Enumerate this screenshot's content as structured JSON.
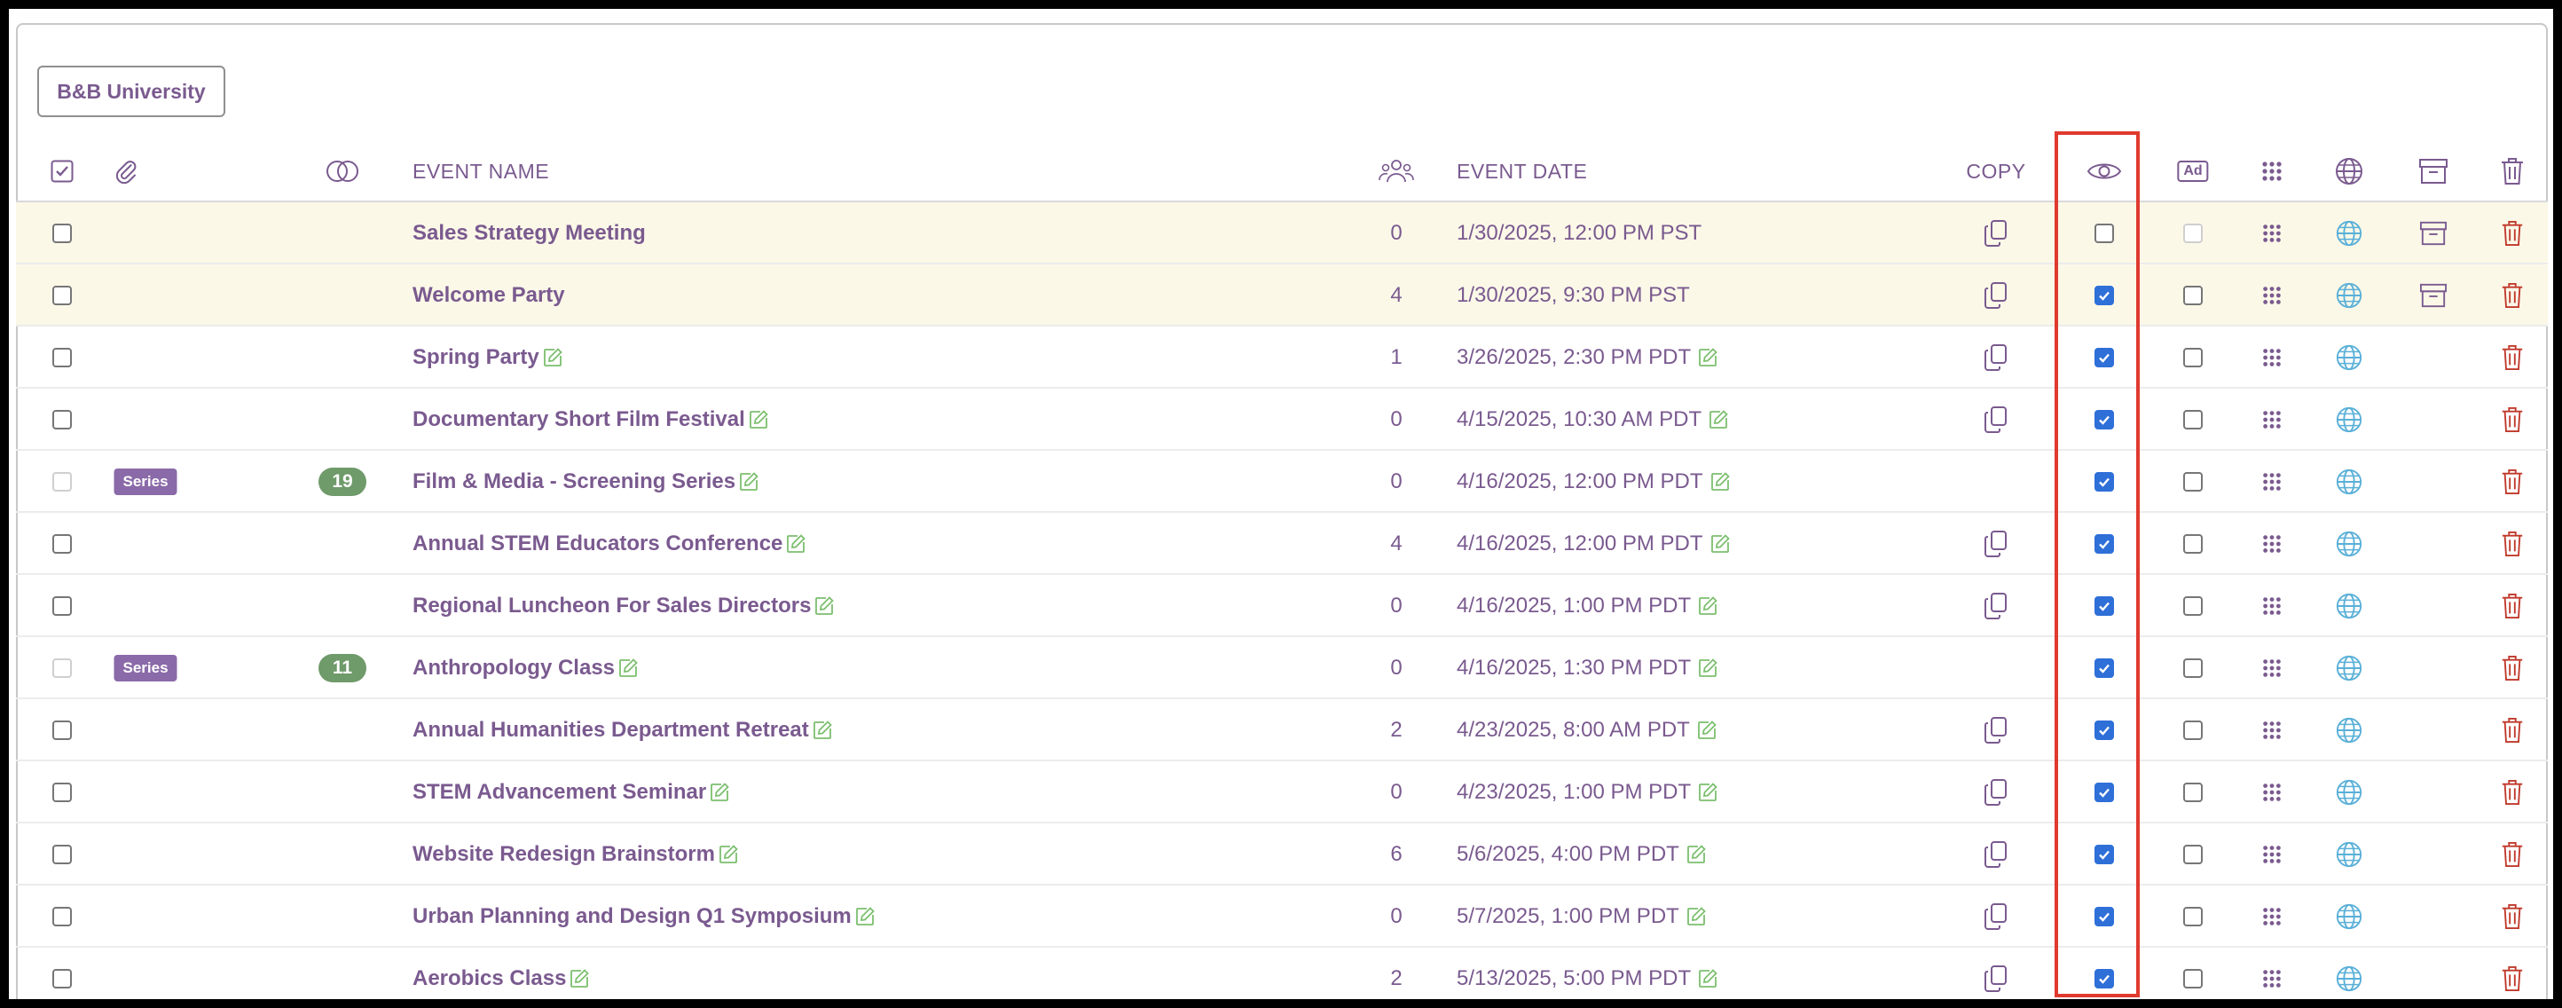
{
  "toolbar": {
    "tag_label": "B&B University"
  },
  "headers": {
    "event_name": "EVENT NAME",
    "event_date": "EVENT DATE",
    "copy": "COPY",
    "ad": "Ad"
  },
  "colors": {
    "accent": "#7a5a8f",
    "highlight_row": "#fbf8e8",
    "checkbox_checked": "#2e6fd8",
    "edit_icon": "#7cbf6e",
    "globe_icon": "#5ab0d8",
    "delete_icon": "#c0392b",
    "series_badge": "#8a6aa8",
    "count_badge": "#6f9a6a",
    "focus_box": "#e03a2f"
  },
  "rows": [
    {
      "name": "Sales Strategy Meeting",
      "attendees": "0",
      "date": "1/30/2025, 12:00 PM PST",
      "series": false,
      "series_label": "",
      "series_count": "",
      "editable": false,
      "copy": true,
      "visible": false,
      "ad": false,
      "ad_disabled": true,
      "archive": true,
      "highlight": true,
      "select_disabled": false
    },
    {
      "name": "Welcome Party",
      "attendees": "4",
      "date": "1/30/2025, 9:30 PM PST",
      "series": false,
      "series_label": "",
      "series_count": "",
      "editable": false,
      "copy": true,
      "visible": true,
      "ad": false,
      "ad_disabled": false,
      "archive": true,
      "highlight": true,
      "select_disabled": false
    },
    {
      "name": "Spring Party",
      "attendees": "1",
      "date": "3/26/2025, 2:30 PM PDT",
      "series": false,
      "series_label": "",
      "series_count": "",
      "editable": true,
      "copy": true,
      "visible": true,
      "ad": false,
      "ad_disabled": false,
      "archive": false,
      "highlight": false,
      "select_disabled": false
    },
    {
      "name": "Documentary Short Film Festival",
      "attendees": "0",
      "date": "4/15/2025, 10:30 AM PDT",
      "series": false,
      "series_label": "",
      "series_count": "",
      "editable": true,
      "copy": true,
      "visible": true,
      "ad": false,
      "ad_disabled": false,
      "archive": false,
      "highlight": false,
      "select_disabled": false
    },
    {
      "name": "Film & Media - Screening Series",
      "attendees": "0",
      "date": "4/16/2025, 12:00 PM PDT",
      "series": true,
      "series_label": "Series",
      "series_count": "19",
      "editable": true,
      "copy": false,
      "visible": true,
      "ad": false,
      "ad_disabled": false,
      "archive": false,
      "highlight": false,
      "select_disabled": true
    },
    {
      "name": "Annual STEM Educators Conference",
      "attendees": "4",
      "date": "4/16/2025, 12:00 PM PDT",
      "series": false,
      "series_label": "",
      "series_count": "",
      "editable": true,
      "copy": true,
      "visible": true,
      "ad": false,
      "ad_disabled": false,
      "archive": false,
      "highlight": false,
      "select_disabled": false
    },
    {
      "name": "Regional Luncheon For Sales Directors",
      "attendees": "0",
      "date": "4/16/2025, 1:00 PM PDT",
      "series": false,
      "series_label": "",
      "series_count": "",
      "editable": true,
      "copy": true,
      "visible": true,
      "ad": false,
      "ad_disabled": false,
      "archive": false,
      "highlight": false,
      "select_disabled": false
    },
    {
      "name": "Anthropology Class",
      "attendees": "0",
      "date": "4/16/2025, 1:30 PM PDT",
      "series": true,
      "series_label": "Series",
      "series_count": "11",
      "editable": true,
      "copy": false,
      "visible": true,
      "ad": false,
      "ad_disabled": false,
      "archive": false,
      "highlight": false,
      "select_disabled": true
    },
    {
      "name": "Annual Humanities Department Retreat",
      "attendees": "2",
      "date": "4/23/2025, 8:00 AM PDT",
      "series": false,
      "series_label": "",
      "series_count": "",
      "editable": true,
      "copy": true,
      "visible": true,
      "ad": false,
      "ad_disabled": false,
      "archive": false,
      "highlight": false,
      "select_disabled": false
    },
    {
      "name": "STEM Advancement Seminar",
      "attendees": "0",
      "date": "4/23/2025, 1:00 PM PDT",
      "series": false,
      "series_label": "",
      "series_count": "",
      "editable": true,
      "copy": true,
      "visible": true,
      "ad": false,
      "ad_disabled": false,
      "archive": false,
      "highlight": false,
      "select_disabled": false
    },
    {
      "name": "Website Redesign Brainstorm",
      "attendees": "6",
      "date": "5/6/2025, 4:00 PM PDT",
      "series": false,
      "series_label": "",
      "series_count": "",
      "editable": true,
      "copy": true,
      "visible": true,
      "ad": false,
      "ad_disabled": false,
      "archive": false,
      "highlight": false,
      "select_disabled": false
    },
    {
      "name": "Urban Planning and Design Q1 Symposium",
      "attendees": "0",
      "date": "5/7/2025, 1:00 PM PDT",
      "series": false,
      "series_label": "",
      "series_count": "",
      "editable": true,
      "copy": true,
      "visible": true,
      "ad": false,
      "ad_disabled": false,
      "archive": false,
      "highlight": false,
      "select_disabled": false
    },
    {
      "name": "Aerobics Class",
      "attendees": "2",
      "date": "5/13/2025, 5:00 PM PDT",
      "series": false,
      "series_label": "",
      "series_count": "",
      "editable": true,
      "copy": true,
      "visible": true,
      "ad": false,
      "ad_disabled": false,
      "archive": false,
      "highlight": false,
      "select_disabled": false
    }
  ]
}
